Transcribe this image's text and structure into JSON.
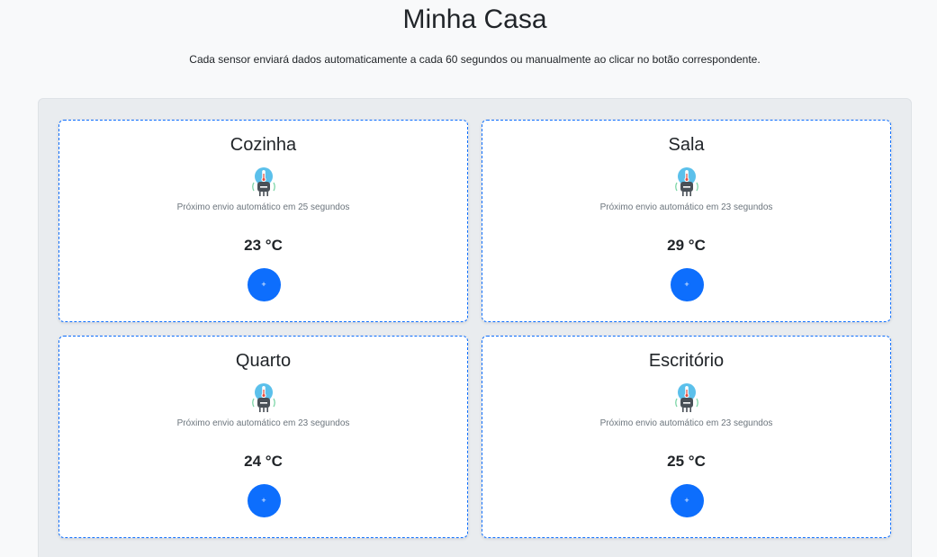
{
  "header": {
    "title": "Minha Casa",
    "subtitle": "Cada sensor enviará dados automaticamente a cada 60 segundos ou manualmente ao clicar no botão correspondente."
  },
  "colors": {
    "accent": "#0d6efd",
    "icon_cyan": "#5bc0eb",
    "icon_dark": "#495057"
  },
  "sensors": [
    {
      "name": "Cozinha",
      "icon": "thermometer-sensor-icon",
      "next_send": "Próximo envio automático em 25 segundos",
      "temperature": "23 °C",
      "button_label": "+"
    },
    {
      "name": "Sala",
      "icon": "thermometer-sensor-icon",
      "next_send": "Próximo envio automático em 23 segundos",
      "temperature": "29 °C",
      "button_label": "+"
    },
    {
      "name": "Quarto",
      "icon": "thermometer-sensor-icon",
      "next_send": "Próximo envio automático em 23 segundos",
      "temperature": "24 °C",
      "button_label": "+"
    },
    {
      "name": "Escritório",
      "icon": "thermometer-sensor-icon",
      "next_send": "Próximo envio automático em 23 segundos",
      "temperature": "25 °C",
      "button_label": "+"
    }
  ]
}
